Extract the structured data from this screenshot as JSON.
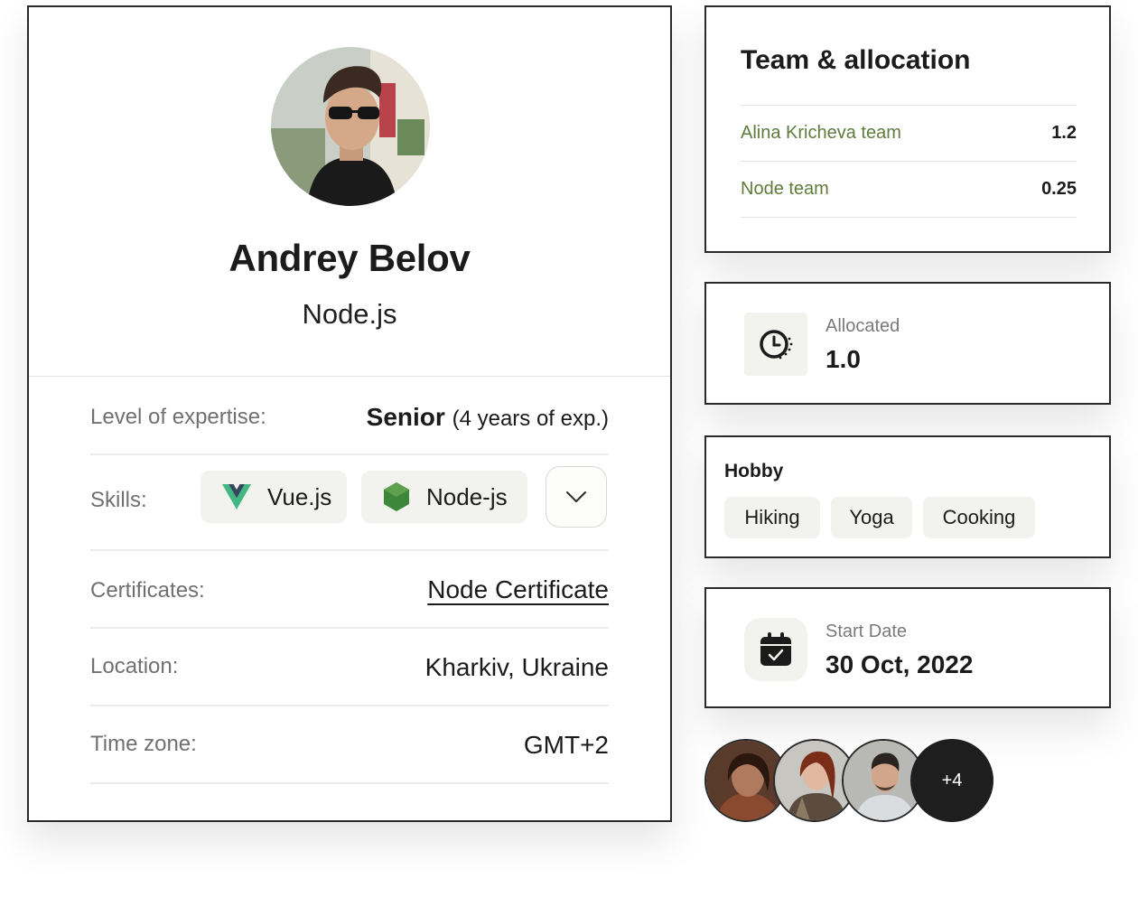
{
  "profile": {
    "name": "Andrey Belov",
    "role": "Node.js",
    "expertise": {
      "label": "Level of expertise:",
      "level": "Senior",
      "years": "(4 years of exp.)"
    },
    "skills": {
      "label": "Skills:",
      "items": [
        {
          "name": "Vue.js",
          "icon": "vue-icon"
        },
        {
          "name": "Node-js",
          "icon": "nodejs-icon"
        }
      ],
      "expand_icon": "chevron-down-icon"
    },
    "certificates": {
      "label": "Certificates:",
      "value": "Node Certificate"
    },
    "location": {
      "label": "Location:",
      "value": "Kharkiv, Ukraine"
    },
    "timezone": {
      "label": "Time zone:",
      "value": "GMT+2"
    }
  },
  "team": {
    "title": "Team & allocation",
    "rows": [
      {
        "name": "Alina Kricheva team",
        "value": "1.2"
      },
      {
        "name": "Node team",
        "value": "0.25"
      }
    ]
  },
  "allocated": {
    "label": "Allocated",
    "value": "1.0",
    "icon": "timer-icon"
  },
  "hobby": {
    "title": "Hobby",
    "tags": [
      "Hiking",
      "Yoga",
      "Cooking"
    ]
  },
  "start_date": {
    "label": "Start Date",
    "value": "30 Oct, 2022",
    "icon": "calendar-check-icon"
  },
  "people": {
    "more": "+4"
  },
  "colors": {
    "accent_green": "#5e7b3c",
    "chip_bg": "#f2f2ef",
    "dark": "#1e1e1e"
  }
}
